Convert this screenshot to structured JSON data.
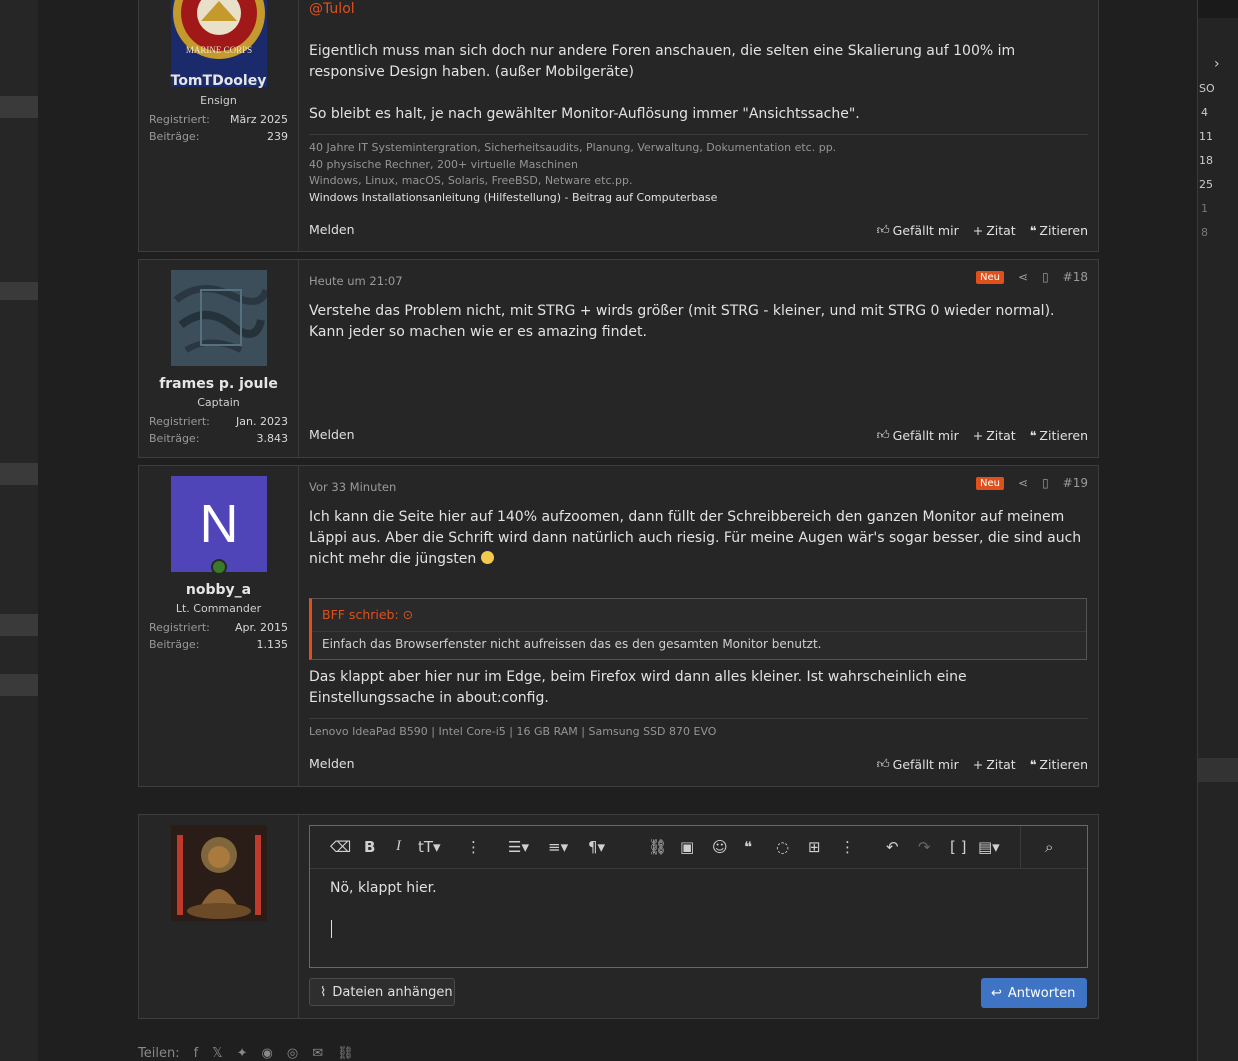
{
  "colors": {
    "accent": "#e0501d",
    "link": "#3e6fb2",
    "button": "#3f74c4"
  },
  "posts": [
    {
      "user": {
        "name": "TomTDooley",
        "title": "Ensign",
        "registered_label": "Registriert:",
        "registered": "März 2025",
        "posts_label": "Beiträge:",
        "posts": "239",
        "avatar": "marine-corps-emblem"
      },
      "mention": "@Tulol",
      "paragraph1": "Eigentlich muss man sich doch nur andere Foren anschauen, die selten eine Skalierung auf 100% im responsive Design haben. (außer Mobilgeräte)",
      "paragraph2": "So bleibt es halt, je nach gewählter Monitor-Auflösung immer \"Ansichtssache\".",
      "signature": [
        "40 Jahre IT Systemintergration, Sicherheitsaudits, Planung, Verwaltung, Dokumentation etc. pp.",
        "40 physische Rechner, 200+ virtuelle Maschinen",
        "Windows, Linux, macOS, Solaris, FreeBSD, Netware etc.pp."
      ],
      "signature_link": "Windows Installationsanleitung (Hilfestellung) - Beitrag auf Computerbase"
    },
    {
      "user": {
        "name": "frames p. joule",
        "title": "Captain",
        "registered_label": "Registriert:",
        "registered": "Jan. 2023",
        "posts_label": "Beiträge:",
        "posts": "3.843",
        "avatar": "graffiti-avatar"
      },
      "date": "Heute um 21:07",
      "badge": "Neu",
      "number": "#18",
      "paragraph1": "Verstehe das Problem nicht, mit STRG + wirds größer (mit STRG - kleiner, und mit STRG 0 wieder normal). Kann jeder so machen wie er es amazing findet."
    },
    {
      "user": {
        "name": "nobby_a",
        "title": "Lt. Commander",
        "registered_label": "Registriert:",
        "registered": "Apr. 2015",
        "posts_label": "Beiträge:",
        "posts": "1.135",
        "avatar_letter": "N"
      },
      "date": "Vor 33 Minuten",
      "badge": "Neu",
      "number": "#19",
      "paragraph1": "Ich kann die Seite hier auf 140% aufzoomen, dann füllt der Schreibbereich den ganzen Monitor auf meinem Läppi aus. Aber die Schrift wird dann natürlich auch riesig. Für meine Augen wär's sogar besser, die sind auch nicht mehr die jüngsten",
      "quote_author": "BFF schrieb:",
      "quote_text": "Einfach das Browserfenster nicht aufreissen das es den gesamten Monitor benutzt.",
      "paragraph2": "Das klappt aber hier nur im Edge, beim Firefox wird dann alles kleiner. Ist wahrscheinlich eine Einstellungssache in about:config.",
      "signature": "Lenovo IdeaPad B590 | Intel Core-i5 | 16 GB RAM | Samsung SSD 870 EVO"
    }
  ],
  "actions": {
    "report": "Melden",
    "like": "Gefällt mir",
    "quote": "Zitat",
    "reply_quote": "Zitieren"
  },
  "editor": {
    "text": "Nö, klappt hier.",
    "attach": "Dateien anhängen",
    "submit": "Antworten",
    "toolbar_icons": [
      "eraser-icon",
      "bold-icon",
      "italic-icon",
      "text-size-icon",
      "more-icon",
      "list-icon",
      "align-icon",
      "paragraph-icon",
      "link-icon",
      "image-icon",
      "smiley-icon",
      "quote-icon",
      "spoiler-icon",
      "table-icon",
      "more-icon",
      "undo-icon",
      "redo-icon",
      "bbcode-icon",
      "drafts-icon",
      "preview-icon"
    ]
  },
  "share": {
    "label": "Teilen:"
  },
  "right_column": {
    "header": "SO",
    "values": [
      "4",
      "11",
      "18",
      "25",
      "1",
      "8"
    ]
  }
}
